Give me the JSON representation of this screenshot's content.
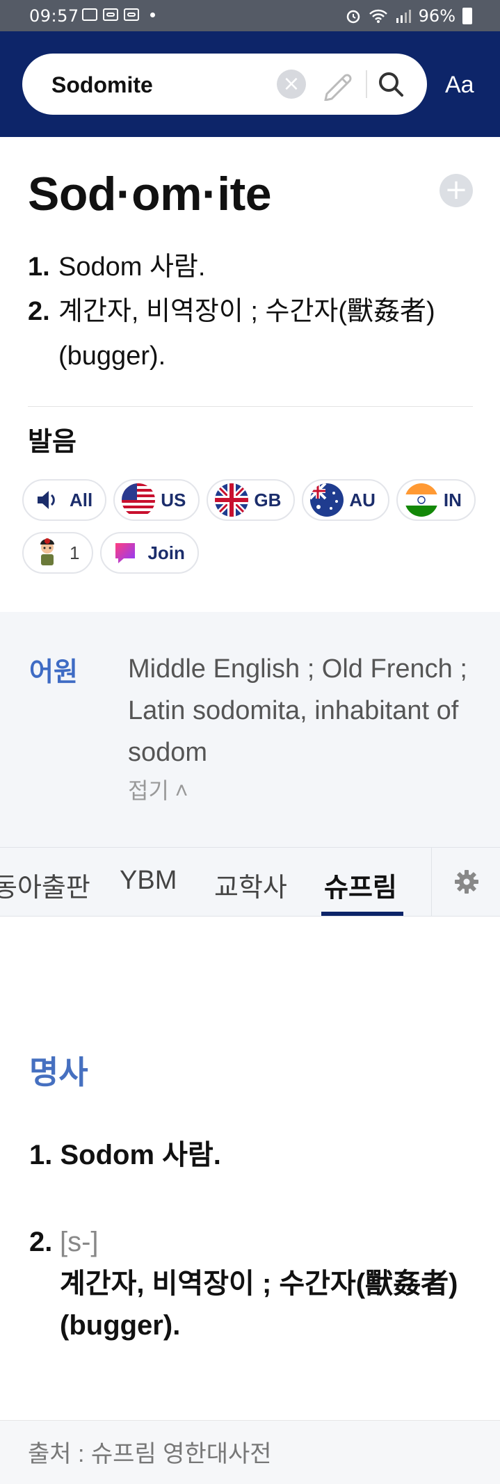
{
  "status_bar": {
    "time": "09:57",
    "battery": "96%"
  },
  "search": {
    "value": "Sodomite",
    "font_button": "Aa"
  },
  "entry": {
    "headword": "Sod·om·ite",
    "definitions": [
      {
        "num": "1.",
        "text": "Sodom 사람."
      },
      {
        "num": "2.",
        "text": "계간자, 비역장이 ; 수간자(獸姦者)(bugger)."
      }
    ]
  },
  "pronunciation": {
    "title": "발음",
    "buttons": [
      {
        "label": "All",
        "icon": "speaker-icon"
      },
      {
        "label": "US",
        "icon": "us-flag-icon"
      },
      {
        "label": "GB",
        "icon": "gb-flag-icon"
      },
      {
        "label": "AU",
        "icon": "au-flag-icon"
      },
      {
        "label": "IN",
        "icon": "in-flag-icon"
      }
    ],
    "extra": [
      {
        "label": "1",
        "icon": "user-avatar-icon"
      },
      {
        "label": "Join",
        "icon": "chat-bubble-icon"
      }
    ]
  },
  "etymology": {
    "label": "어원",
    "text": "Middle English ; Old French ; Latin sodomita, inhabitant of sodom",
    "fold": "접기 ˄"
  },
  "tabs": [
    "동아출판",
    "YBM",
    "교학사",
    "슈프림"
  ],
  "active_tab": "슈프림",
  "dictionary": {
    "pos": "명사",
    "senses": [
      {
        "num": "1.",
        "text": "Sodom 사람."
      },
      {
        "num": "2.",
        "tag": "[s-]",
        "text": "계간자, 비역장이 ; 수간자(獸姦者)(bugger)."
      }
    ],
    "source": "출처 : 슈프림 영한대사전"
  },
  "colors": {
    "header": "#0d2569",
    "accent": "#4670c0",
    "etym_bg": "#f4f6f9"
  }
}
